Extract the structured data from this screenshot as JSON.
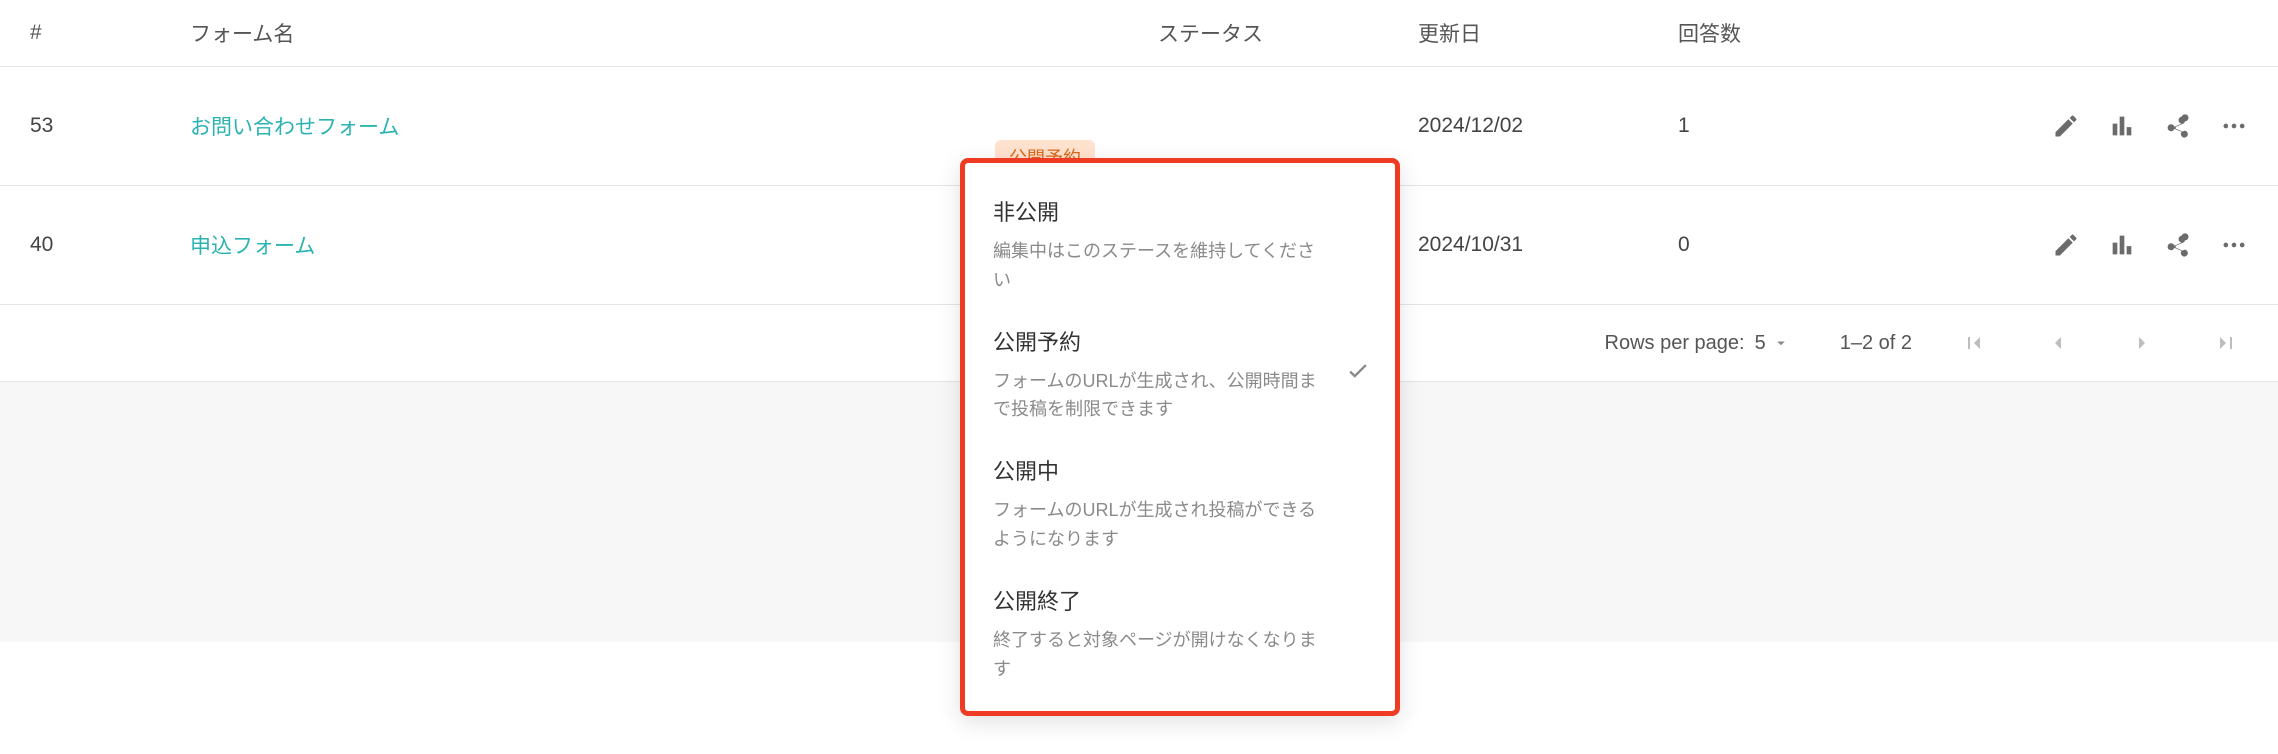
{
  "columns": {
    "id": "#",
    "name": "フォーム名",
    "status": "ステータス",
    "date": "更新日",
    "count": "回答数"
  },
  "rows": [
    {
      "id": "53",
      "name": "お問い合わせフォーム",
      "status": "公開予約",
      "date": "2024/12/02",
      "count": "1"
    },
    {
      "id": "40",
      "name": "申込フォーム",
      "status": "",
      "date": "2024/10/31",
      "count": "0"
    }
  ],
  "pagination": {
    "rows_per_page_label": "Rows per page:",
    "rows_per_page_value": "5",
    "range_text": "1–2 of 2"
  },
  "status_menu": {
    "items": [
      {
        "title": "非公開",
        "desc": "編集中はこのステースを維持してください",
        "selected": false
      },
      {
        "title": "公開予約",
        "desc": "フォームのURLが生成され、公開時間まで投稿を制限できます",
        "selected": true
      },
      {
        "title": "公開中",
        "desc": "フォームのURLが生成され投稿ができるようになります",
        "selected": false
      },
      {
        "title": "公開終了",
        "desc": "終了すると対象ページが開けなくなります",
        "selected": false
      }
    ]
  }
}
